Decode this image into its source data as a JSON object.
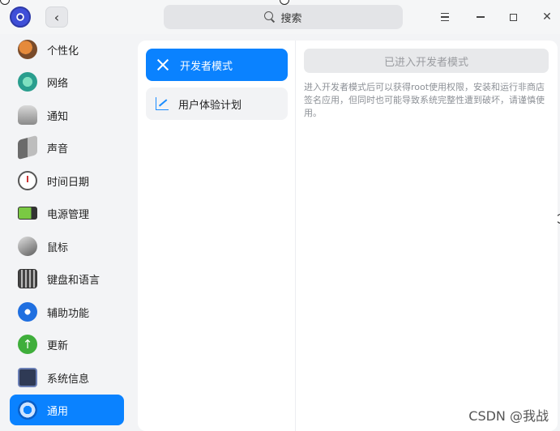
{
  "titlebar": {
    "back_label": "‹",
    "search_placeholder": "搜索"
  },
  "sidebar": {
    "items": [
      {
        "label": "个性化",
        "icon": "personalization-icon"
      },
      {
        "label": "网络",
        "icon": "network-icon"
      },
      {
        "label": "通知",
        "icon": "bell-icon"
      },
      {
        "label": "声音",
        "icon": "speaker-icon"
      },
      {
        "label": "时间日期",
        "icon": "clock-icon"
      },
      {
        "label": "电源管理",
        "icon": "battery-icon"
      },
      {
        "label": "鼠标",
        "icon": "mouse-icon"
      },
      {
        "label": "键盘和语言",
        "icon": "keyboard-icon"
      },
      {
        "label": "辅助功能",
        "icon": "accessibility-icon"
      },
      {
        "label": "更新",
        "icon": "update-icon"
      },
      {
        "label": "系统信息",
        "icon": "system-info-icon"
      },
      {
        "label": "通用",
        "icon": "general-icon",
        "active": true
      }
    ]
  },
  "subnav": {
    "items": [
      {
        "label": "开发者模式",
        "icon": "tools-icon",
        "active": true
      },
      {
        "label": "用户体验计划",
        "icon": "chart-icon"
      }
    ]
  },
  "content": {
    "dev_button_label": "已进入开发者模式",
    "description": "进入开发者模式后可以获得root使用权限，安装和运行非商店签名应用，但同时也可能导致系统完整性遭到破坏，请谨慎使用。"
  },
  "watermark": "CSDN @我战",
  "colors": {
    "accent": "#0a82ff",
    "background": "#f3f4f6",
    "panel": "#ffffff"
  }
}
